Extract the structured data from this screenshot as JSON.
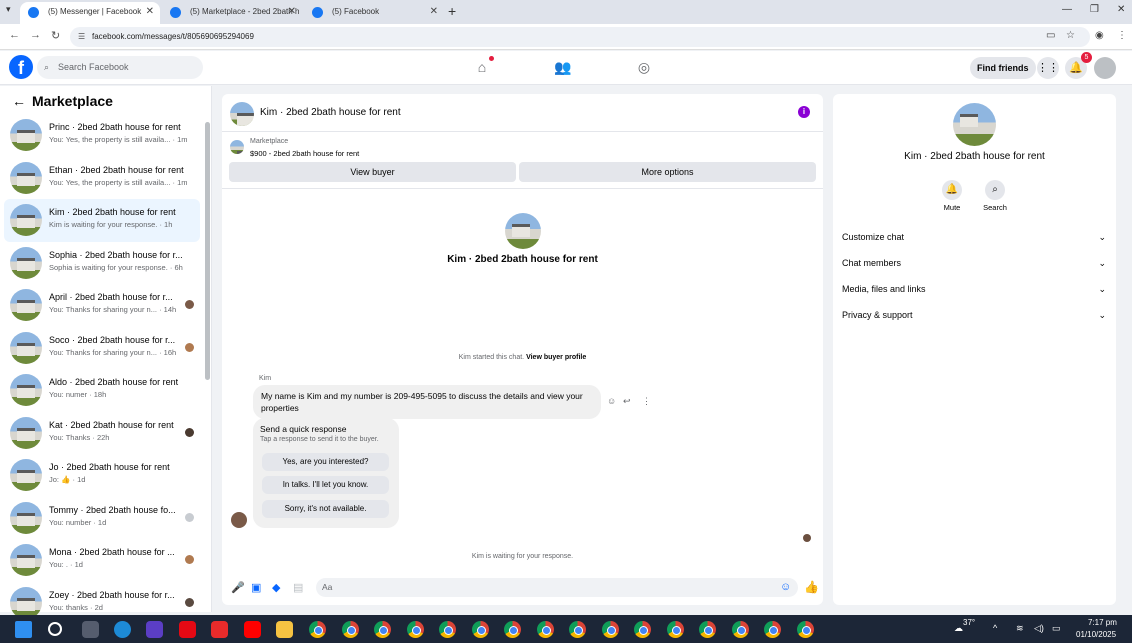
{
  "browser": {
    "tabs": [
      {
        "title": "(5) Messenger | Facebook",
        "active": true
      },
      {
        "title": "(5) Marketplace - 2bed 2bath h",
        "active": false
      },
      {
        "title": "(5) Facebook",
        "active": false
      }
    ],
    "url": "facebook.com/messages/t/805690695294069"
  },
  "fb_header": {
    "search_placeholder": "Search Facebook",
    "find_friends": "Find friends",
    "notif_count": "5"
  },
  "sidebar": {
    "title": "Marketplace",
    "chats": [
      {
        "name": "Princ · 2bed 2bath house for rent",
        "preview": "You: Yes, the property is still availa... · 1m",
        "active": false
      },
      {
        "name": "Ethan · 2bed 2bath house for rent",
        "preview": "You: Yes, the property is still availa... · 1m",
        "active": false
      },
      {
        "name": "Kim · 2bed 2bath house for rent",
        "preview": "Kim is waiting for your response. · 1h",
        "active": true
      },
      {
        "name": "Sophia · 2bed 2bath house for r...",
        "preview": "Sophia is waiting for your response. · 6h",
        "active": false
      },
      {
        "name": "April · 2bed 2bath house for r...",
        "preview": "You: Thanks for sharing your n... · 14h",
        "active": false
      },
      {
        "name": "Soco · 2bed 2bath house for r...",
        "preview": "You: Thanks for sharing your n... · 16h",
        "active": false
      },
      {
        "name": "Aldo · 2bed 2bath house for rent",
        "preview": "You: numer · 18h",
        "active": false
      },
      {
        "name": "Kat · 2bed 2bath house for rent",
        "preview": "You: Thanks · 22h",
        "active": false
      },
      {
        "name": "Jo · 2bed 2bath house for rent",
        "preview": "Jo: 👍 · 1d",
        "active": false
      },
      {
        "name": "Tommy · 2bed 2bath house fo...",
        "preview": "You: number · 1d",
        "active": false
      },
      {
        "name": "Mona · 2bed 2bath house for ...",
        "preview": "You: . · 1d",
        "active": false
      },
      {
        "name": "Zoey · 2bed 2bath house for r...",
        "preview": "You: thanks · 2d",
        "active": false
      }
    ]
  },
  "chat": {
    "title": "Kim · 2bed 2bath house for rent",
    "marketplace_label": "Marketplace",
    "listing": "$900 - 2bed 2bath house for rent",
    "view_buyer": "View buyer",
    "more_options": "More options",
    "started_prefix": "Kim started this chat.",
    "view_profile": "View buyer profile",
    "sender": "Kim",
    "message": "My name is Kim and my number is 209-495-5095 to discuss the details and view your properties",
    "quick_title": "Send a quick response",
    "quick_sub": "Tap a response to send it to the buyer.",
    "quick_replies": [
      "Yes, are you interested?",
      "In talks. I'll let you know.",
      "Sorry, it's not available."
    ],
    "waiting": "Kim is waiting for your response.",
    "composer_placeholder": "Aa"
  },
  "details": {
    "name": "Kim · 2bed 2bath house for rent",
    "mute": "Mute",
    "search": "Search",
    "sections": [
      "Customize chat",
      "Chat members",
      "Media, files and links",
      "Privacy & support"
    ]
  },
  "taskbar": {
    "temp": "37°",
    "time": "7:17 pm",
    "date": "01/10/2025"
  }
}
